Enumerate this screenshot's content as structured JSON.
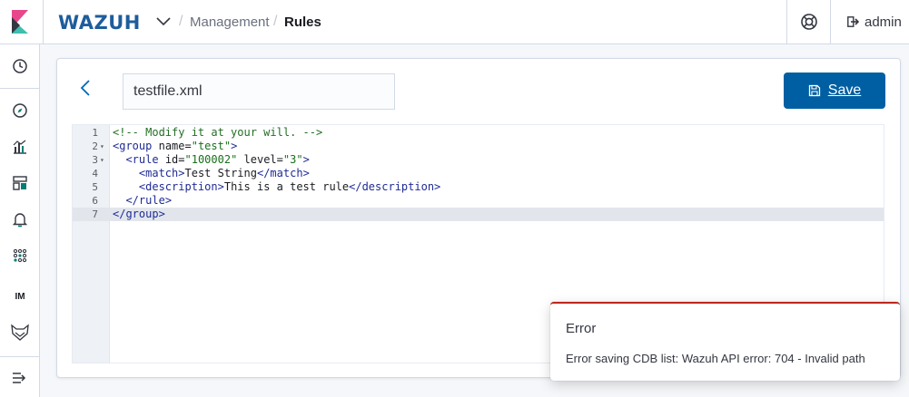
{
  "header": {
    "brand": "WAZUH",
    "breadcrumbs": [
      "Management",
      "Rules"
    ],
    "user": "admin"
  },
  "sidenav": {
    "items": [
      "clock-icon",
      "compass-icon",
      "visualize-icon",
      "dashboard-icon",
      "bell-icon",
      "apps-icon",
      "IM",
      "wazuh-icon",
      "collapse-icon"
    ]
  },
  "editor": {
    "file_name": "testfile.xml",
    "save_label": "Save",
    "line_numbers": [
      "1",
      "2",
      "3",
      "4",
      "5",
      "6",
      "7"
    ],
    "fold_markers": [
      "",
      "▾",
      "▾",
      "",
      "",
      "",
      ""
    ],
    "active_line": 7,
    "lines": [
      "<!-- Modify it at your will. -->",
      "<group name=\"test\">",
      "  <rule id=\"100002\" level=\"3\">",
      "    <match>Test String</match>",
      "    <description>This is a test rule</description>",
      "  </rule>",
      "</group>"
    ]
  },
  "toast": {
    "title": "Error",
    "message": "Error saving CDB list: Wazuh API error: 704 - Invalid path"
  },
  "colors": {
    "primary": "#005fa3",
    "brand": "#1e5d9c",
    "danger": "#bd271e"
  }
}
